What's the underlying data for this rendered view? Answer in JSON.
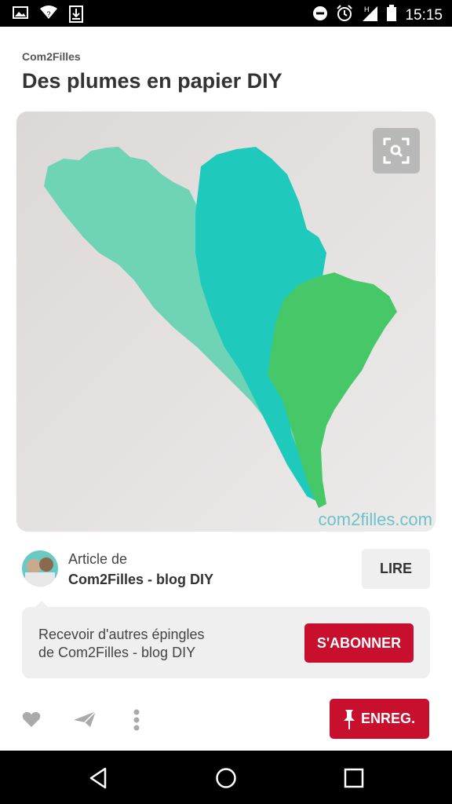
{
  "status_bar": {
    "time": "15:15",
    "left_icons": [
      "image-icon",
      "wifi-question-icon",
      "download-icon"
    ],
    "right_icons": [
      "do-not-disturb-icon",
      "alarm-icon",
      "signal-h-icon",
      "battery-icon"
    ],
    "signal_label": "H"
  },
  "pin": {
    "source": "Com2Filles",
    "title": "Des plumes en papier DIY",
    "image_alt": "paper feathers",
    "watermark": "com2filles.com"
  },
  "article": {
    "prefix": "Article de",
    "author": "Com2Filles - blog DIY",
    "read_label": "LIRE"
  },
  "follow": {
    "line1": "Recevoir d'autres épingles",
    "line2": "de Com2Filles - blog DIY",
    "button_label": "S'ABONNER"
  },
  "actions": {
    "save_label": "ENREG."
  },
  "colors": {
    "accent_red": "#c8102e",
    "light_gray": "#efefef"
  }
}
